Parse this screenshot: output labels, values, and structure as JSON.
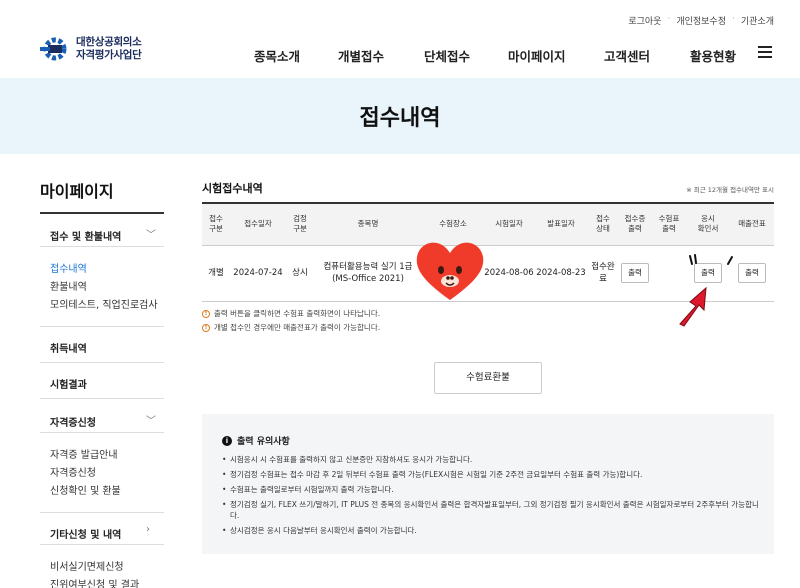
{
  "header": {
    "util_links": [
      "로그아웃",
      "개인정보수정",
      "기관소개"
    ],
    "logo": {
      "line1": "대한상공회의소",
      "line2": "자격평가사업단"
    },
    "nav": [
      "종목소개",
      "개별접수",
      "단체접수",
      "마이페이지",
      "고객센터",
      "활용현황"
    ]
  },
  "banner": {
    "title": "접수내역"
  },
  "sidebar": {
    "title": "마이페이지",
    "groups": [
      {
        "label": "접수 및 환불내역",
        "expand": "﹀",
        "items": [
          "접수내역",
          "환불내역",
          "모의테스트, 직업진로검사"
        ]
      },
      {
        "label": "취득내역"
      },
      {
        "label": "시험결과"
      },
      {
        "label": "자격증신청",
        "expand": "﹀",
        "items": [
          "자격증 발급안내",
          "자격증신청",
          "신청확인 및 환불"
        ]
      },
      {
        "label": "기타신청 및 내역",
        "expand": "›",
        "items": [
          "비서실기면제신청",
          "진위여부신청 및 결과"
        ]
      }
    ]
  },
  "section": {
    "title": "시험접수내역",
    "note": "※ 최근 12개월 접수내역만 표시"
  },
  "table": {
    "headers": [
      "접수\n구분",
      "접수일자",
      "검정\n구분",
      "종목명",
      "수험장소",
      "시험일자",
      "발표일자",
      "접수\n상태",
      "접수증\n출력",
      "수험표\n출력",
      "응시\n확인서",
      "매출전표"
    ],
    "row": {
      "type": "개별",
      "reg_date": "2024-07-24",
      "exam_kind": "상시",
      "subject_line1": "컴퓨터활용능력 실기 1급",
      "subject_line2": "(MS-Office 2021)",
      "place": "",
      "exam_date": "2024-08-06",
      "result_date": "2024-08-23",
      "status": "접수완료",
      "print_label": "출력"
    }
  },
  "warnings": [
    "출력 버튼을 클릭하면 수험표 출력화면이 나타납니다.",
    "개별 접수인 경우에만 매출전표가 출력이 가능합니다."
  ],
  "refund_button": "수험료환불",
  "notice": {
    "title": "출력 유의사항",
    "items": [
      "시험응시 시 수험표를 출력하지 않고 신분증만 지참하셔도 응시가 가능합니다.",
      "정기검정 수험표는 접수 마감 후 2일 뒤부터 수험표 출력 가능(FLEX시험은 시험일 기준 2주전 금요일부터 수험표 출력 가능)합니다.",
      "수험표는 출력일로부터 시험일까지 출력 가능합니다.",
      "정기검정 실기, FLEX 쓰기/말하기, IT PLUS 전 종목의 응시확인서 출력은 합격자발표일부터, 그외 정기검정 필기 응시확인서 출력은 시험일자로부터 2주후부터 가능합니다.",
      "상시검정은 응시 다음날부터 응시확인서 출력이 가능합니다."
    ]
  },
  "colors": {
    "banner_bg": "#eaf4fb",
    "active_link": "#1a73d9",
    "brand": "#1a2b5e",
    "heart": "#f03a2a",
    "arrow": "#e0182d"
  }
}
